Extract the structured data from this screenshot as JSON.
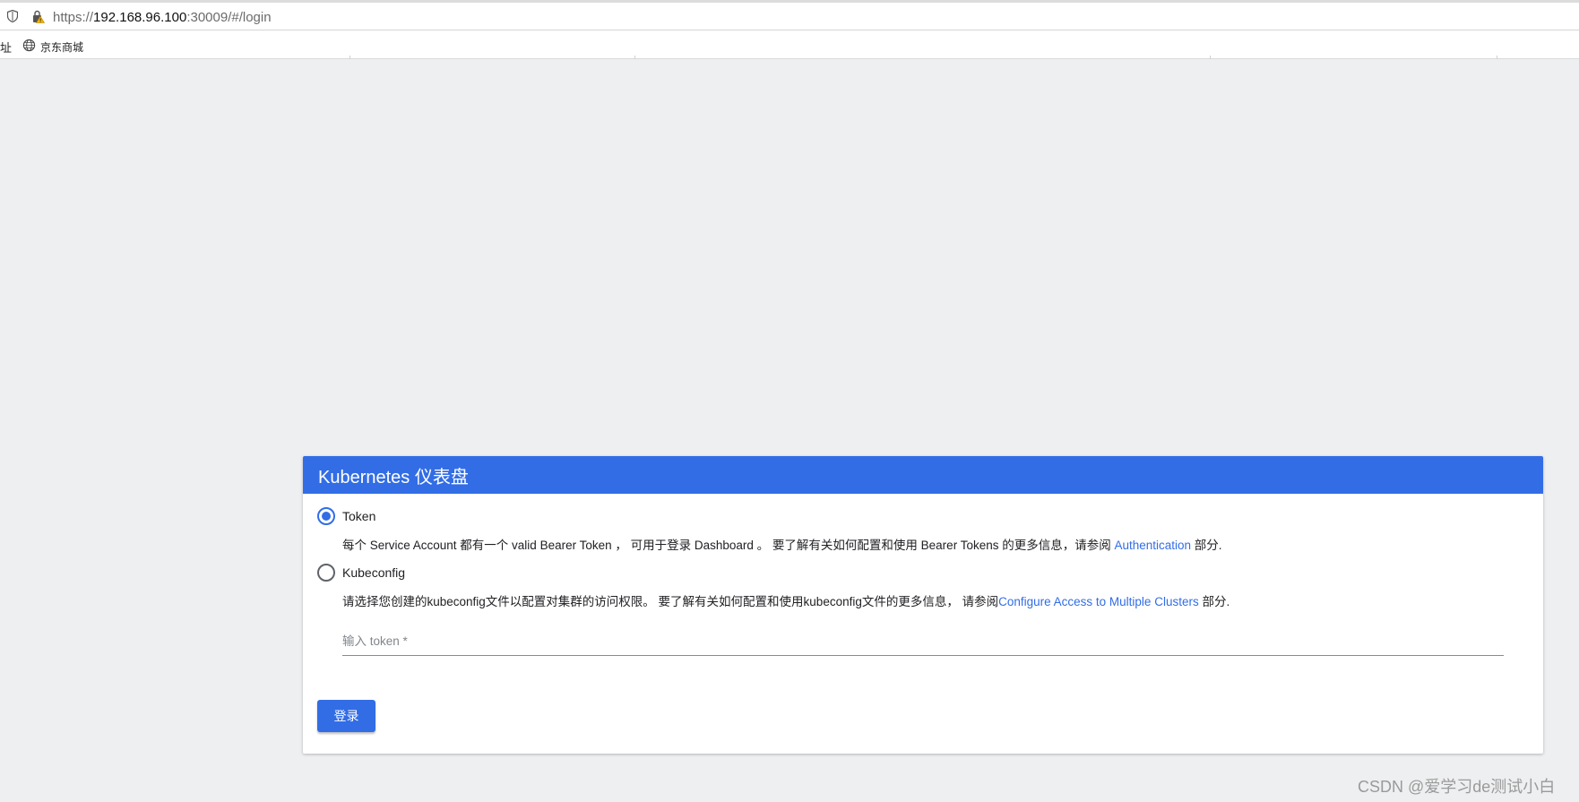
{
  "browser": {
    "url_scheme": "https://",
    "url_host": "192.168.96.100",
    "url_rest": ":30009/#/login",
    "bookmark_cut": "址",
    "bookmark_label": "京东商城"
  },
  "card": {
    "title": "Kubernetes 仪表盘",
    "token_option": {
      "label": "Token",
      "checked": true,
      "desc_text": "每个 Service Account 都有一个 valid Bearer Token ， 可用于登录 Dashboard 。 要了解有关如何配置和使用 Bearer Tokens 的更多信息，请参阅 ",
      "desc_link": "Authentication",
      "desc_suffix": " 部分."
    },
    "kubeconfig_option": {
      "label": "Kubeconfig",
      "checked": false,
      "desc_text": "请选择您创建的kubeconfig文件以配置对集群的访问权限。 要了解有关如何配置和使用kubeconfig文件的更多信息， 请参阅",
      "desc_link": "Configure Access to Multiple Clusters",
      "desc_suffix": " 部分."
    },
    "token_input": {
      "placeholder": "输入 token *",
      "value": ""
    },
    "login_label": "登录"
  },
  "watermark": "CSDN @爱学习de测试小白",
  "colors": {
    "primary": "#326de6",
    "background": "#eeeff1"
  }
}
